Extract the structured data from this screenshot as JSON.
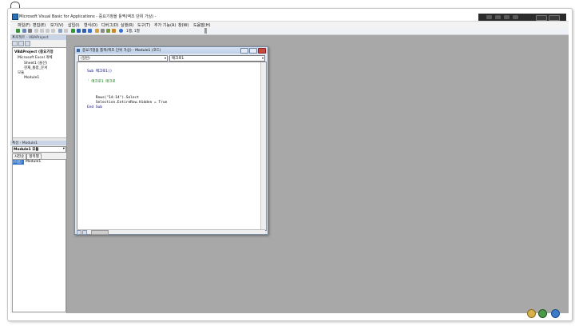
{
  "window": {
    "title": "Microsoft Visual Basic for Applications - 중요기정을 틀찍(엑조 단위 가상) -",
    "colors": {
      "workspace": "#a8a8a8",
      "menubar": "#f3f3f3",
      "selection": "#3173c6"
    }
  },
  "menu": {
    "items": [
      "파일(F)",
      "편집(E)",
      "보기(V)",
      "삽입(I)",
      "형식(O)",
      "디버그(D)",
      "실행(R)",
      "도구(T)",
      "추가 기능(A)",
      "창(W)",
      "도움말(H)"
    ]
  },
  "toolbar": {
    "position_label": "1행, 1열"
  },
  "project_panel": {
    "title": "프로젝트 - VBAProject",
    "tree": [
      "VBAProject (중요기정",
      "Microsoft Excel 개체",
      "Sheet1 (울산)",
      "현재_통합_문서",
      "모듈",
      "Module1"
    ]
  },
  "properties_panel": {
    "title": "속성 - Module1",
    "object_combo": "Module1 모듈",
    "tabs": [
      "사전순",
      "항목별"
    ],
    "rows": [
      {
        "key": "(이름)",
        "value": "Module1"
      }
    ]
  },
  "code_window": {
    "title": "중요기정을 틀찍(엑조 단위 가상) - Module1 (코드)",
    "object_combo": "(일반)",
    "proc_combo": "매크로1",
    "lines": [
      {
        "text": "Sub 매크로1()",
        "type": "kw"
      },
      {
        "text": "",
        "type": "plain"
      },
      {
        "text": "' 매크로1 매크로",
        "type": "cm"
      },
      {
        "text": "",
        "type": "plain"
      },
      {
        "text": "",
        "type": "plain"
      },
      {
        "text": "    Rows(\"14:14\").Select",
        "type": "plain"
      },
      {
        "text": "    Selection.EntireRow.Hidden = True",
        "type": "plain"
      },
      {
        "text": "End Sub",
        "type": "kw"
      }
    ]
  }
}
